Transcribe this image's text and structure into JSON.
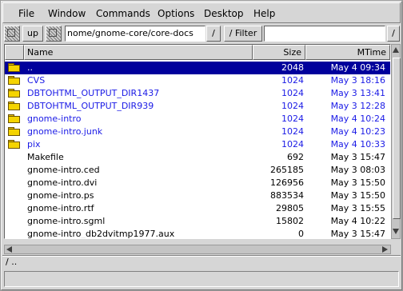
{
  "menu": [
    "File",
    "Window",
    "Commands",
    "Options",
    "Desktop",
    "Help"
  ],
  "toolbar": {
    "up_label": "up",
    "path": "nome/gnome-core/core-docs",
    "path_button": "/",
    "filter_label": "/ Filter",
    "filter_value": "",
    "right_button": "/"
  },
  "columns": {
    "name": "Name",
    "size": "Size",
    "mtime": "MTime"
  },
  "files": [
    {
      "name": "..",
      "size": "2048",
      "mtime": "May  4 09:34",
      "type": "dir",
      "selected": true
    },
    {
      "name": "CVS",
      "size": "1024",
      "mtime": "May  3 18:16",
      "type": "dir"
    },
    {
      "name": "DBTOHTML_OUTPUT_DIR1437",
      "size": "1024",
      "mtime": "May  3 13:41",
      "type": "dir"
    },
    {
      "name": "DBTOHTML_OUTPUT_DIR939",
      "size": "1024",
      "mtime": "May  3 12:28",
      "type": "dir"
    },
    {
      "name": "gnome-intro",
      "size": "1024",
      "mtime": "May  4 10:24",
      "type": "dir"
    },
    {
      "name": "gnome-intro.junk",
      "size": "1024",
      "mtime": "May  4 10:23",
      "type": "dir"
    },
    {
      "name": "pix",
      "size": "1024",
      "mtime": "May  4 10:33",
      "type": "dir"
    },
    {
      "name": "Makefile",
      "size": "692",
      "mtime": "May  3 15:47",
      "type": "file"
    },
    {
      "name": "gnome-intro.ced",
      "size": "265185",
      "mtime": "May  3 08:03",
      "type": "file"
    },
    {
      "name": "gnome-intro.dvi",
      "size": "126956",
      "mtime": "May  3 15:50",
      "type": "file"
    },
    {
      "name": "gnome-intro.ps",
      "size": "883534",
      "mtime": "May  3 15:50",
      "type": "file"
    },
    {
      "name": "gnome-intro.rtf",
      "size": "29805",
      "mtime": "May  3 15:55",
      "type": "file"
    },
    {
      "name": "gnome-intro.sgml",
      "size": "15802",
      "mtime": "May  4 10:22",
      "type": "file"
    },
    {
      "name": "gnome-intro_db2dvitmp1977.aux",
      "size": "0",
      "mtime": "May  3 15:47",
      "type": "file"
    }
  ],
  "status_line": "/ ..",
  "colors": {
    "selection": "#00009c",
    "dir_text": "#1a1ae6",
    "folder": "#f5d400"
  }
}
